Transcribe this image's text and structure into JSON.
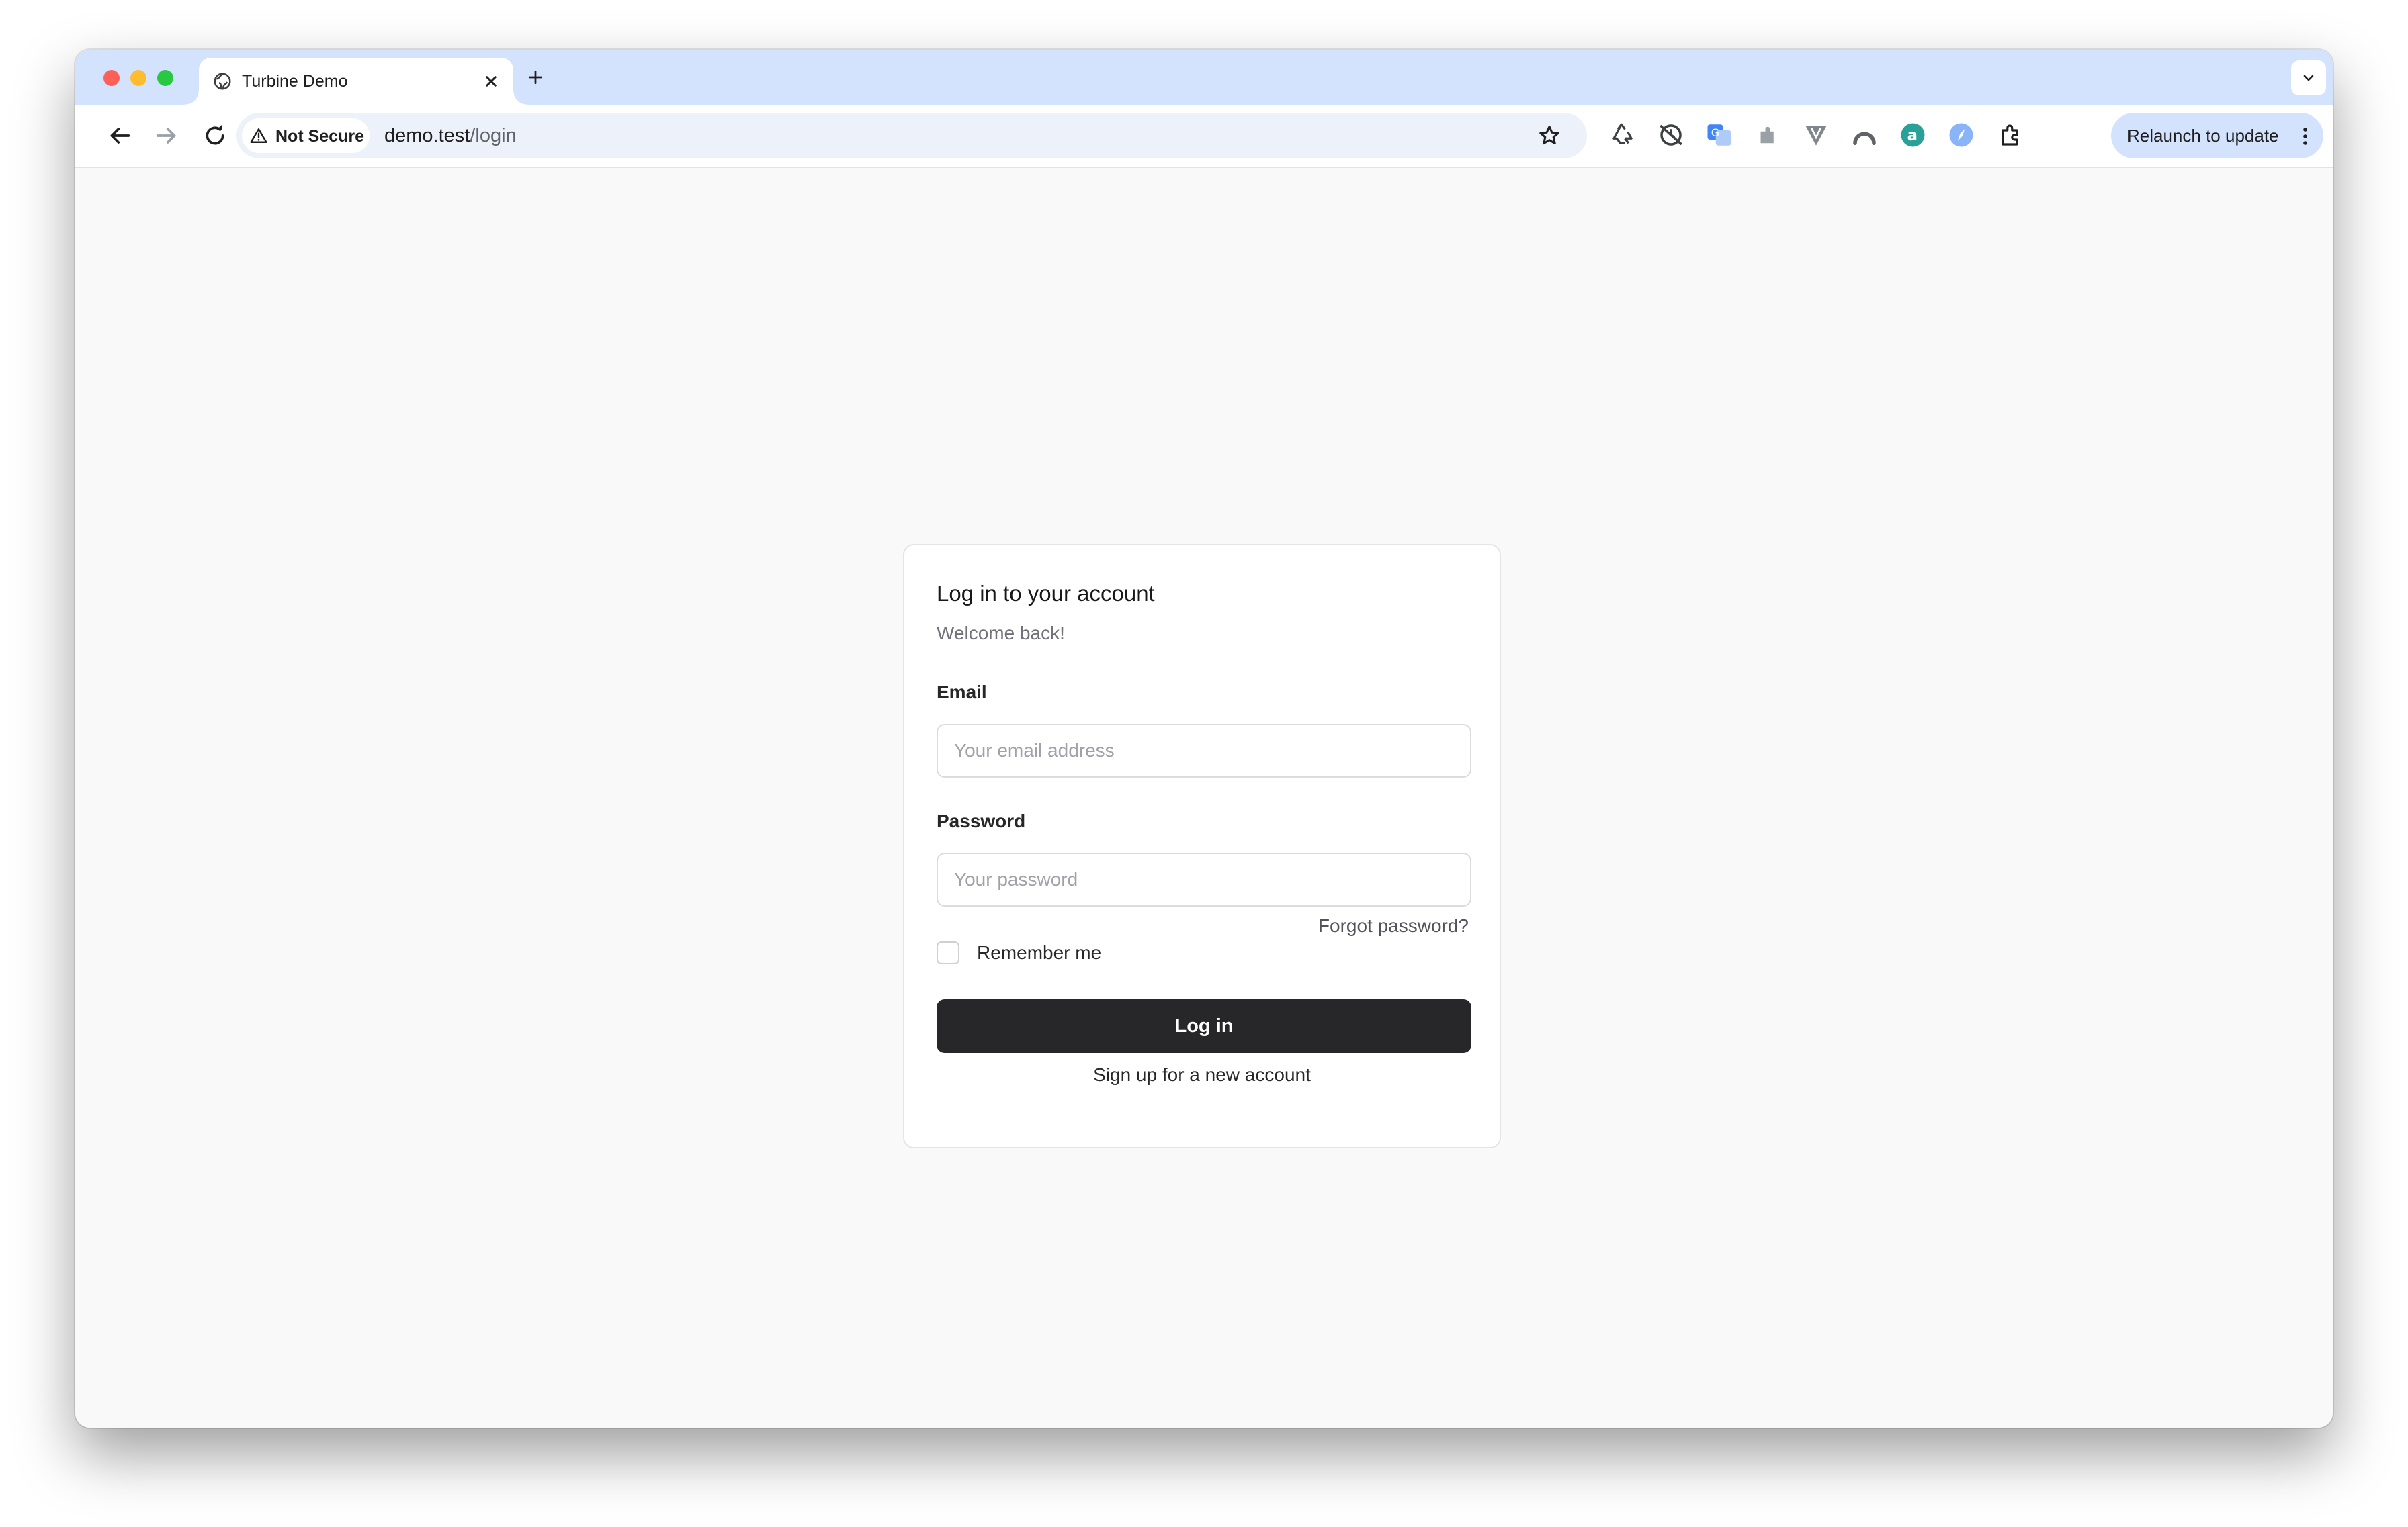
{
  "browser": {
    "tab_title": "Turbine Demo",
    "security_chip": "Not Secure",
    "url_host": "demo.test",
    "url_path": "/login",
    "relaunch_label": "Relaunch to update",
    "extensions": [
      "recycle-icon",
      "clock-sync-icon",
      "translate-icon",
      "puzzle-piece-icon",
      "v-shield-icon",
      "arc-icon",
      "a-circle-icon",
      "compass-icon",
      "extensions-icon"
    ]
  },
  "login": {
    "title": "Log in to your account",
    "subtitle": "Welcome back!",
    "email_label": "Email",
    "email_placeholder": "Your email address",
    "email_value": "",
    "password_label": "Password",
    "password_placeholder": "Your password",
    "password_value": "",
    "forgot_password": "Forgot password?",
    "remember_me": "Remember me",
    "remember_checked": false,
    "submit_label": "Log in",
    "signup_link": "Sign up for a new account"
  },
  "colors": {
    "tabstrip": "#d3e3fd",
    "page_background": "#f9f9f9",
    "primary_button": "#27272a",
    "muted_text": "#71717a"
  }
}
